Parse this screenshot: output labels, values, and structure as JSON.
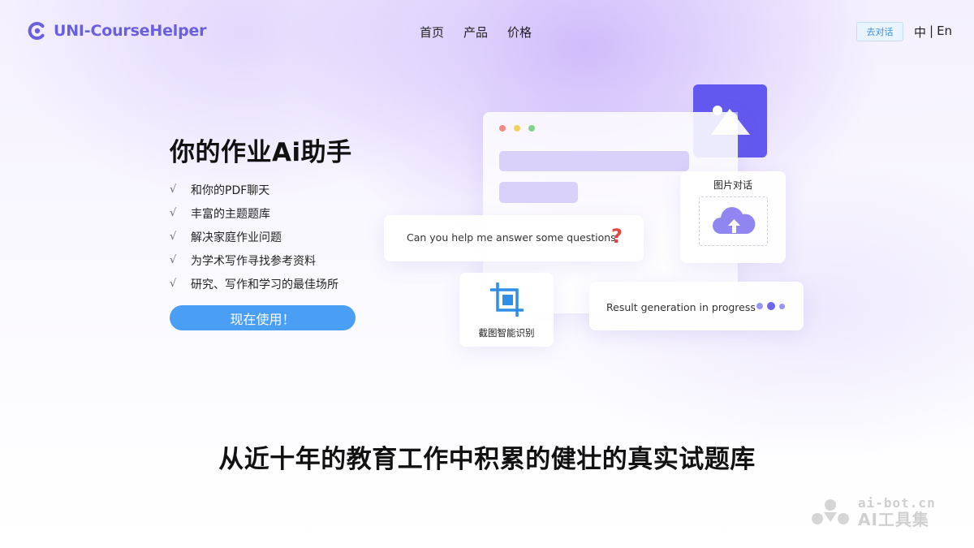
{
  "header": {
    "brand": "UNI-CourseHelper",
    "nav": [
      "首页",
      "产品",
      "价格"
    ],
    "chat_button": "去对话",
    "lang_zh": "中",
    "lang_sep": "|",
    "lang_en": "En"
  },
  "hero": {
    "title": "你的作业Ai助手",
    "check": "√",
    "features": [
      "和你的PDF聊天",
      "丰富的主题题库",
      "解决家庭作业问题",
      "为学术写作寻找参考资料",
      "研究、写作和学习的最佳场所"
    ],
    "cta": "现在使用！"
  },
  "illustration": {
    "question": "Can you help me answer some questions",
    "question_mark": "?",
    "image_chat": "图片对话",
    "crop_ocr": "截图智能识别",
    "result": "Result generation in progress",
    "colors": {
      "accent": "#6258ef",
      "bar": "#d9d1fa",
      "cta": "#4a9ff5"
    }
  },
  "section": {
    "title": "从近十年的教育工作中积累的健壮的真实试题库"
  },
  "watermark": {
    "url": "ai-bot.cn",
    "name": "AI工具集"
  }
}
